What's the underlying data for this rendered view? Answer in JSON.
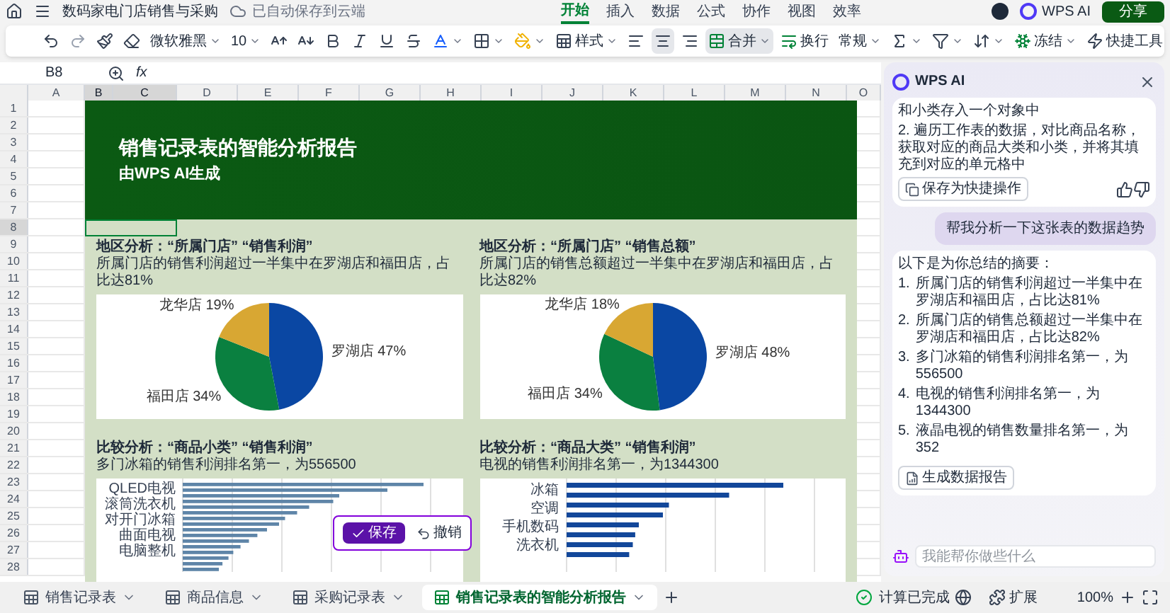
{
  "title_bar": {
    "doc_title": "数码家电门店销售与采购",
    "save_status": "已自动保存到云端",
    "menu_tabs": [
      {
        "label": "开始",
        "selected": true
      },
      {
        "label": "插入",
        "selected": false
      },
      {
        "label": "数据",
        "selected": false
      },
      {
        "label": "公式",
        "selected": false
      },
      {
        "label": "协作",
        "selected": false
      },
      {
        "label": "视图",
        "selected": false
      },
      {
        "label": "效率",
        "selected": false
      }
    ],
    "ai_button": "WPS AI",
    "share_button": "分享"
  },
  "toolbar": {
    "font": "微软雅黑",
    "size": "10",
    "style": "样式",
    "merge": "合并",
    "wrap": "换行",
    "format": "常规",
    "freeze": "冻结",
    "quick_tools": "快捷工具"
  },
  "formula_bar": {
    "cell_ref": "B8",
    "fx": "fx"
  },
  "columns": [
    {
      "label": "A",
      "selected": false
    },
    {
      "label": "B",
      "selected": true
    },
    {
      "label": "C",
      "selected": true
    },
    {
      "label": "D",
      "selected": false
    },
    {
      "label": "E",
      "selected": false
    },
    {
      "label": "F",
      "selected": false
    },
    {
      "label": "G",
      "selected": false
    },
    {
      "label": "H",
      "selected": false
    },
    {
      "label": "I",
      "selected": false
    },
    {
      "label": "J",
      "selected": false
    },
    {
      "label": "K",
      "selected": false
    },
    {
      "label": "L",
      "selected": false
    },
    {
      "label": "M",
      "selected": false
    },
    {
      "label": "N",
      "selected": false
    },
    {
      "label": "O",
      "selected": false
    }
  ],
  "rows": [
    {
      "label": "1",
      "selected": false
    },
    {
      "label": "2",
      "selected": false
    },
    {
      "label": "3",
      "selected": false
    },
    {
      "label": "4",
      "selected": false
    },
    {
      "label": "5",
      "selected": false
    },
    {
      "label": "6",
      "selected": false
    },
    {
      "label": "7",
      "selected": false
    },
    {
      "label": "8",
      "selected": true
    },
    {
      "label": "9",
      "selected": false
    },
    {
      "label": "10",
      "selected": false
    },
    {
      "label": "11",
      "selected": false
    },
    {
      "label": "12",
      "selected": false
    },
    {
      "label": "13",
      "selected": false
    },
    {
      "label": "14",
      "selected": false
    },
    {
      "label": "15",
      "selected": false
    },
    {
      "label": "16",
      "selected": false
    },
    {
      "label": "17",
      "selected": false
    },
    {
      "label": "18",
      "selected": false
    },
    {
      "label": "19",
      "selected": false
    },
    {
      "label": "20",
      "selected": false
    },
    {
      "label": "21",
      "selected": false
    },
    {
      "label": "22",
      "selected": false
    },
    {
      "label": "23",
      "selected": false
    },
    {
      "label": "24",
      "selected": false
    },
    {
      "label": "25",
      "selected": false
    },
    {
      "label": "26",
      "selected": false
    },
    {
      "label": "27",
      "selected": false
    },
    {
      "label": "28",
      "selected": false
    }
  ],
  "report": {
    "title": "销售记录表的智能分析报告",
    "subtitle": "由WPS AI生成",
    "sections": [
      {
        "kind": "pie",
        "heading": "地区分析：“所属门店” “销售利润”",
        "summary": "所属门店的销售利润超过一半集中在罗湖店和福田店，占比达81%",
        "chart_data": {
          "type": "pie",
          "categories": [
            "罗湖店",
            "福田店",
            "龙华店"
          ],
          "series": [
            {
              "values": [
                47,
                34,
                19
              ]
            }
          ],
          "value_labels": [
            "47%",
            "34%",
            "19%"
          ]
        }
      },
      {
        "kind": "pie",
        "heading": "地区分析：“所属门店” “销售总额”",
        "summary": "所属门店的销售总额超过一半集中在罗湖店和福田店，占比达82%",
        "chart_data": {
          "type": "pie",
          "categories": [
            "罗湖店",
            "福田店",
            "龙华店"
          ],
          "series": [
            {
              "values": [
                48,
                34,
                18
              ]
            }
          ],
          "value_labels": [
            "48%",
            "34%",
            "18%"
          ]
        }
      },
      {
        "kind": "bar",
        "heading": "比较分析：“商品小类” “销售利润”",
        "summary": "多门冰箱的销售利润排名第一，为556500",
        "bar_labels": [
          "QLED电视",
          "滚筒洗衣机",
          "对开门冰箱",
          "曲面电视",
          "电脑整机"
        ]
      },
      {
        "kind": "bar",
        "heading": "比较分析：“商品大类” “销售利润”",
        "summary": "电视的销售利润排名第一，为1344300",
        "bar_labels": [
          "冰箱",
          "空调",
          "手机数码",
          "洗衣机"
        ]
      }
    ]
  },
  "popup": {
    "save": "保存",
    "undo": "撤销"
  },
  "ai_panel": {
    "title": "WPS AI",
    "card_lines": [
      "和小类存入一个对象中",
      "2. 遍历工作表的数据，对比商品名称，获取对应的商品大类和小类，并将其填充到对应的单元格中"
    ],
    "save_action": "保存为快捷操作",
    "user_message": "帮我分析一下这张表的数据趋势",
    "summary_intro": "以下是为你总结的摘要：",
    "summary_items": [
      {
        "number": "1.",
        "text": "所属门店的销售利润超过一半集中在罗湖店和福田店，占比达81%"
      },
      {
        "number": "2.",
        "text": "所属门店的销售总额超过一半集中在罗湖店和福田店，占比达82%"
      },
      {
        "number": "3.",
        "text": "多门冰箱的销售利润排名第一，为556500"
      },
      {
        "number": "4.",
        "text": "电视的销售利润排名第一，为1344300"
      },
      {
        "number": "5.",
        "text": "液晶电视的销售数量排名第一，为352"
      }
    ],
    "report_button": "生成数据报告",
    "input_placeholder": "我能帮你做些什么"
  },
  "sheet_tabs": [
    {
      "label": "销售记录表",
      "selected": false
    },
    {
      "label": "商品信息",
      "selected": false
    },
    {
      "label": "采购记录表",
      "selected": false
    },
    {
      "label": "销售记录表的智能分析报告",
      "selected": true
    }
  ],
  "status_bar": {
    "calc": "计算已完成",
    "extensions": "扩展",
    "zoom": "100%"
  }
}
